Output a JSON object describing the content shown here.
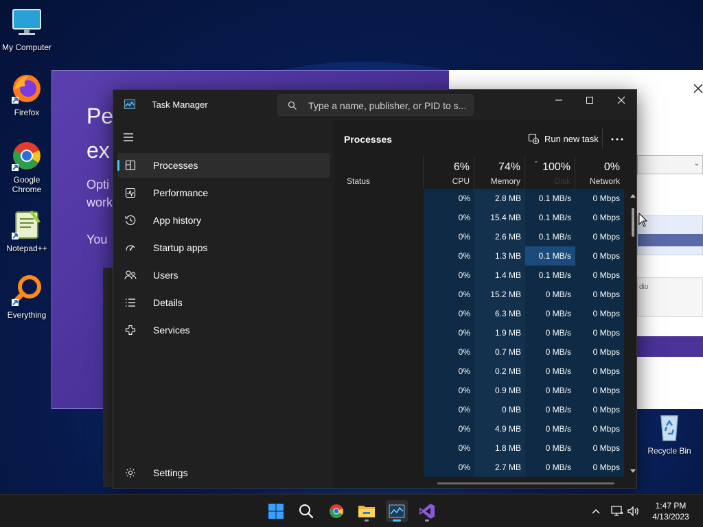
{
  "desktop": {
    "icons": [
      {
        "label": "My Computer"
      },
      {
        "label": "Firefox"
      },
      {
        "label": "Google Chrome"
      },
      {
        "label": "Notepad++"
      },
      {
        "label": "Everything"
      },
      {
        "label": "Recycle Bin"
      }
    ]
  },
  "background_window": {
    "lines": [
      "Pe",
      "ex",
      "Opti",
      "work",
      "You"
    ],
    "right_snippet": "dio"
  },
  "task_manager": {
    "title": "Task Manager",
    "search_placeholder": "Type a name, publisher, or PID to s...",
    "nav": {
      "items": [
        {
          "label": "Processes",
          "icon": "processes-icon"
        },
        {
          "label": "Performance",
          "icon": "performance-icon"
        },
        {
          "label": "App history",
          "icon": "app-history-icon"
        },
        {
          "label": "Startup apps",
          "icon": "startup-apps-icon"
        },
        {
          "label": "Users",
          "icon": "users-icon"
        },
        {
          "label": "Details",
          "icon": "details-icon"
        },
        {
          "label": "Services",
          "icon": "services-icon"
        }
      ],
      "settings_label": "Settings"
    },
    "processes": {
      "title": "Processes",
      "run_new_task": "Run new task",
      "columns": [
        {
          "name": "Status",
          "pct": ""
        },
        {
          "name": "CPU",
          "pct": "6%"
        },
        {
          "name": "Memory",
          "pct": "74%"
        },
        {
          "name": "Disk",
          "pct": "100%"
        },
        {
          "name": "Network",
          "pct": "0%"
        }
      ],
      "rows": [
        [
          "0%",
          "2.8 MB",
          "0.1 MB/s",
          "0 Mbps"
        ],
        [
          "0%",
          "15.4 MB",
          "0.1 MB/s",
          "0 Mbps"
        ],
        [
          "0%",
          "2.6 MB",
          "0.1 MB/s",
          "0 Mbps"
        ],
        [
          "0%",
          "1.3 MB",
          "0.1 MB/s",
          "0 Mbps"
        ],
        [
          "0%",
          "1.4 MB",
          "0.1 MB/s",
          "0 Mbps"
        ],
        [
          "0%",
          "15.2 MB",
          "0 MB/s",
          "0 Mbps"
        ],
        [
          "0%",
          "6.3 MB",
          "0 MB/s",
          "0 Mbps"
        ],
        [
          "0%",
          "1.9 MB",
          "0 MB/s",
          "0 Mbps"
        ],
        [
          "0%",
          "0.7 MB",
          "0 MB/s",
          "0 Mbps"
        ],
        [
          "0%",
          "0.2 MB",
          "0 MB/s",
          "0 Mbps"
        ],
        [
          "0%",
          "0.9 MB",
          "0 MB/s",
          "0 Mbps"
        ],
        [
          "0%",
          "0 MB",
          "0 MB/s",
          "0 Mbps"
        ],
        [
          "0%",
          "4.9 MB",
          "0 MB/s",
          "0 Mbps"
        ],
        [
          "0%",
          "1.8 MB",
          "0 MB/s",
          "0 Mbps"
        ],
        [
          "0%",
          "2.7 MB",
          "0 MB/s",
          "0 Mbps"
        ]
      ]
    }
  },
  "taskbar": {
    "time": "1:47 PM",
    "date": "4/13/2023"
  },
  "colors": {
    "accent": "#4cc2ff",
    "heat_low": "#0f2a44",
    "heat_mid": "#13304d",
    "heat_high": "#1a4b7a"
  }
}
